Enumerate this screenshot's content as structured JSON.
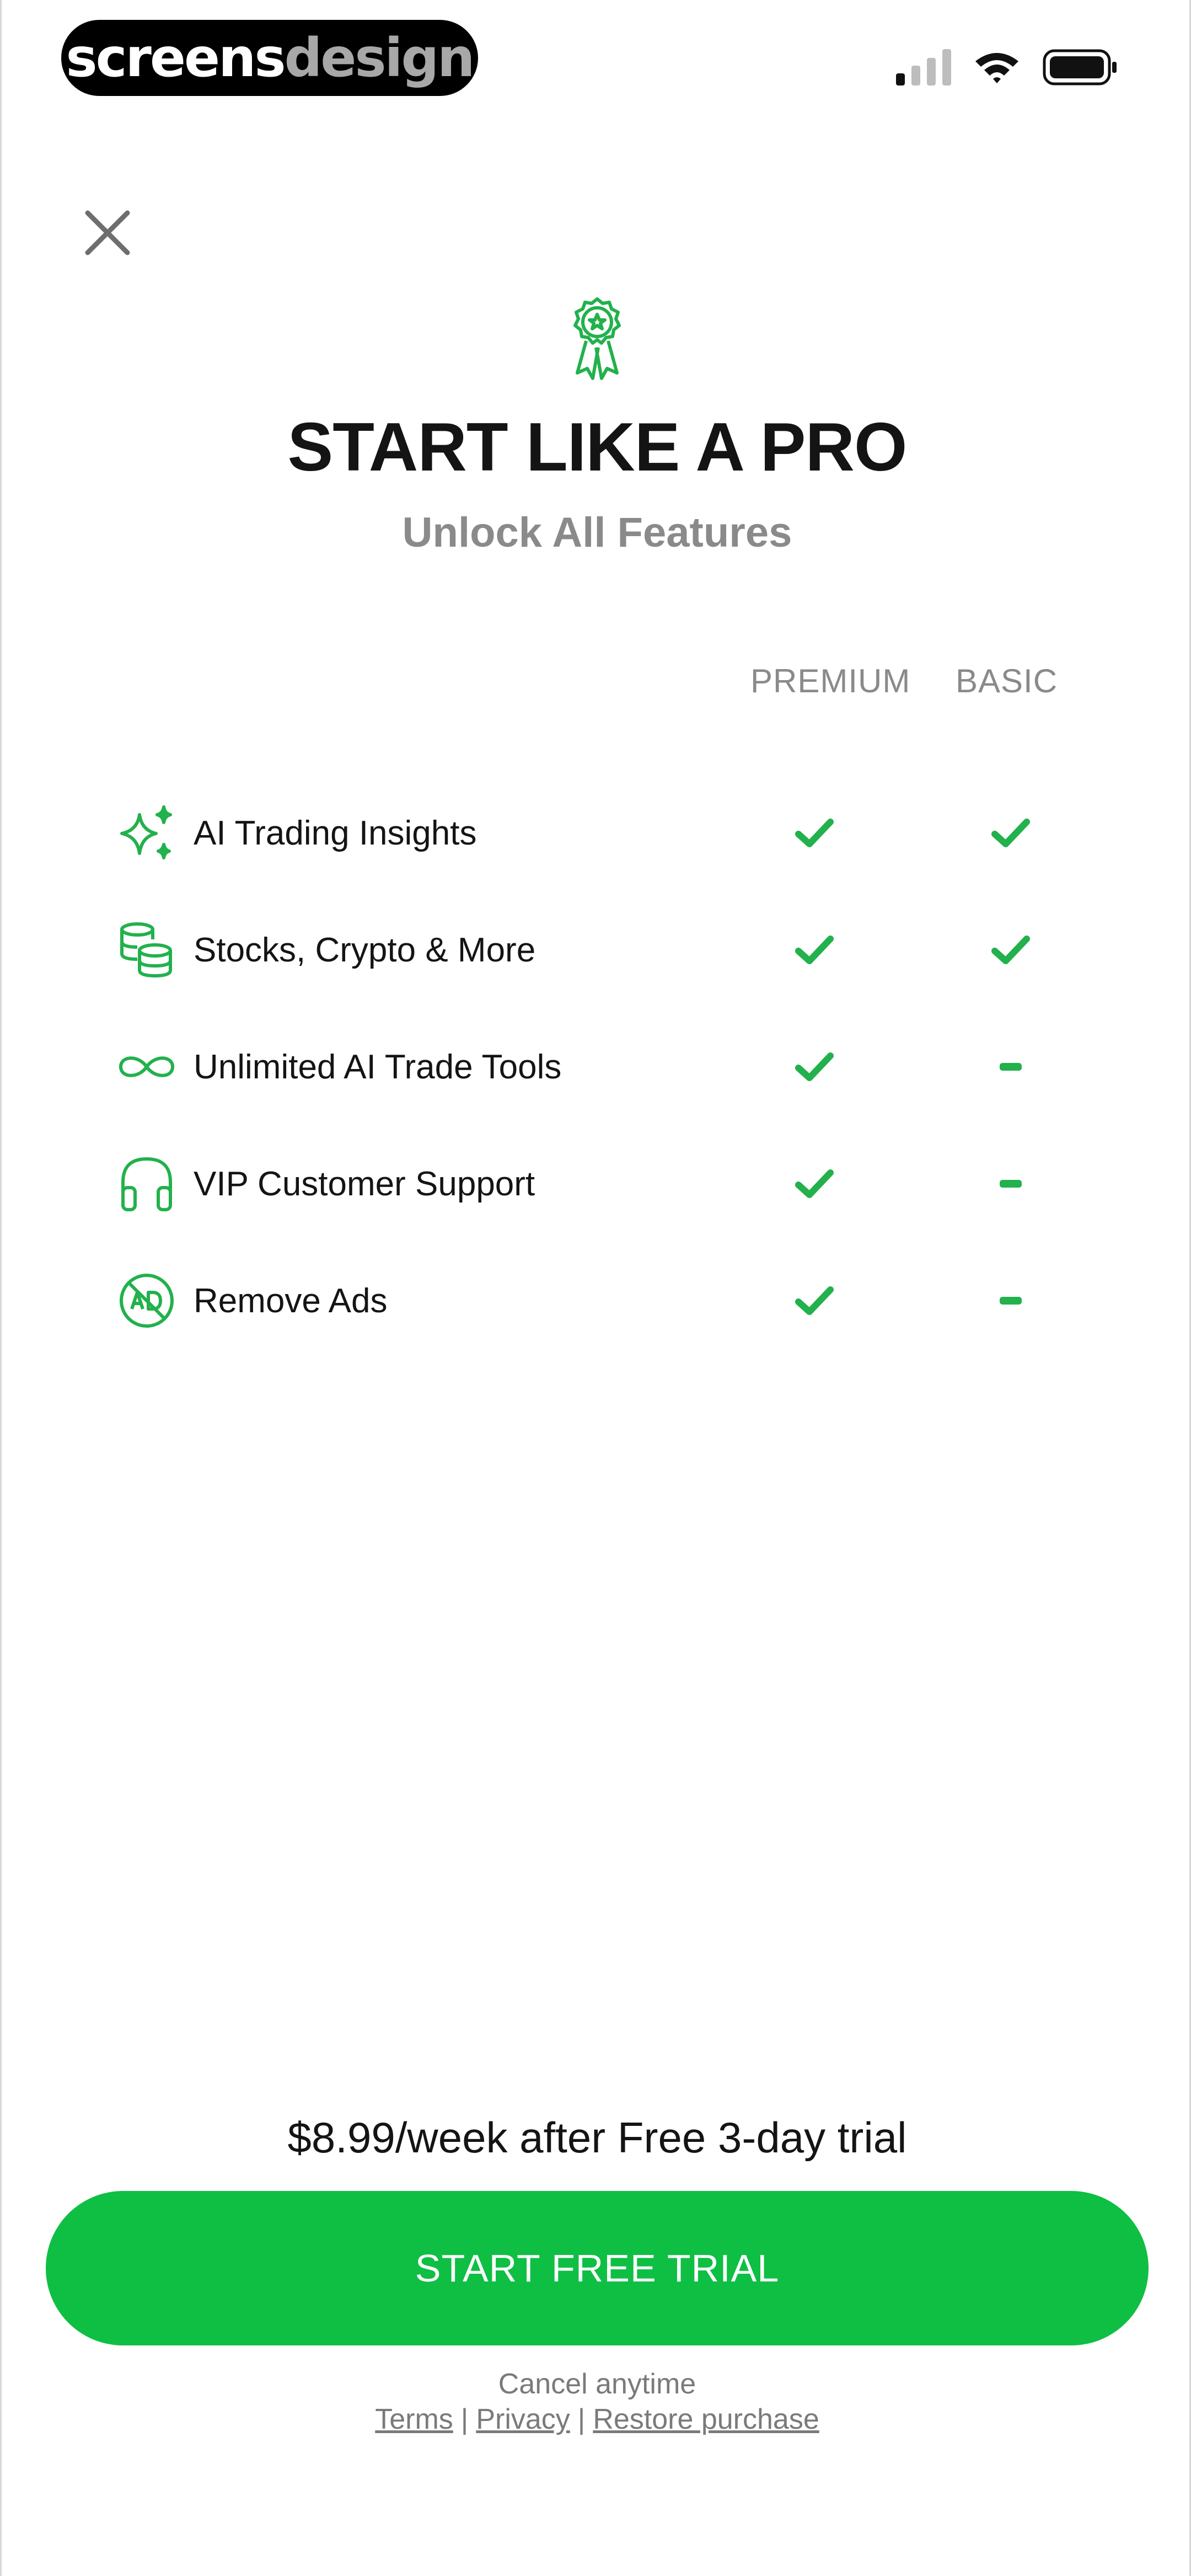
{
  "status_bar": {
    "brand_part1": "screens",
    "brand_part2": "design"
  },
  "header": {
    "title": "START LIKE A PRO",
    "subtitle": "Unlock All Features"
  },
  "table": {
    "columns": [
      "PREMIUM",
      "BASIC"
    ],
    "rows": [
      {
        "icon": "sparkles-icon",
        "label": "AI Trading Insights",
        "premium": "check",
        "basic": "check"
      },
      {
        "icon": "coins-icon",
        "label": "Stocks, Crypto & More",
        "premium": "check",
        "basic": "check"
      },
      {
        "icon": "infinity-icon",
        "label": "Unlimited AI Trade Tools",
        "premium": "check",
        "basic": "dash"
      },
      {
        "icon": "headphones-icon",
        "label": "VIP Customer Support",
        "premium": "check",
        "basic": "dash"
      },
      {
        "icon": "no-ads-icon",
        "label": "Remove Ads",
        "premium": "check",
        "basic": "dash"
      }
    ]
  },
  "footer": {
    "price_text": "$8.99/week after Free 3-day trial",
    "cta_label": "START FREE TRIAL",
    "cancel_text": "Cancel anytime",
    "links": [
      "Terms",
      "Privacy",
      "Restore purchase"
    ],
    "separator": "|"
  },
  "colors": {
    "accent": "#0ebf43",
    "icon_green": "#22b14c",
    "muted": "#8a8a8a"
  }
}
